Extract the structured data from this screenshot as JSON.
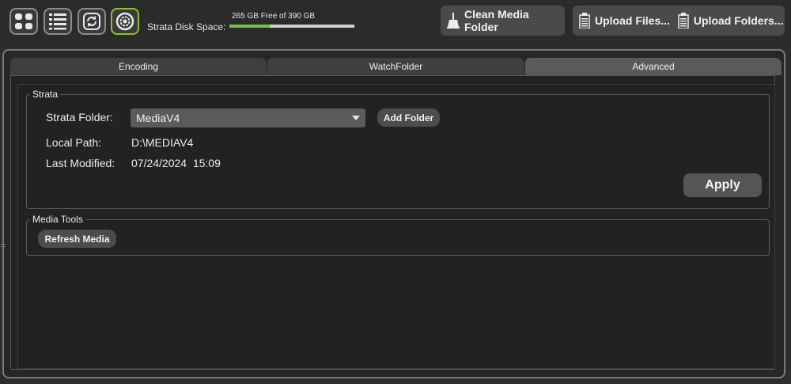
{
  "toolbar": {
    "buttons": [
      {
        "name": "grid-view-icon",
        "active": false
      },
      {
        "name": "list-view-icon",
        "active": false
      },
      {
        "name": "refresh-icon",
        "active": false
      },
      {
        "name": "settings-icon",
        "active": true
      }
    ],
    "disk_label": "Strata Disk Space:",
    "disk_value": "265 GB Free of 390 GB",
    "disk_used_fraction": 0.32,
    "clean_label": "Clean Media Folder",
    "upload_files_label": "Upload Files...",
    "upload_folders_label": "Upload Folders..."
  },
  "tabs": [
    {
      "label": "Encoding",
      "active": false
    },
    {
      "label": "WatchFolder",
      "active": false
    },
    {
      "label": "Advanced",
      "active": true
    }
  ],
  "strata": {
    "legend": "Strata",
    "folder_label": "Strata Folder:",
    "folder_value": "MediaV4",
    "add_folder_label": "Add Folder",
    "local_path_label": "Local Path:",
    "local_path_value": "D:\\MEDIAV4",
    "last_modified_label": "Last Modified:",
    "last_modified_value": "07/24/2024  15:09",
    "apply_label": "Apply"
  },
  "media_tools": {
    "legend": "Media Tools",
    "refresh_label": "Refresh Media"
  },
  "colors": {
    "accent": "#8fbf2f",
    "disk_bar_fill": "#76c044"
  }
}
